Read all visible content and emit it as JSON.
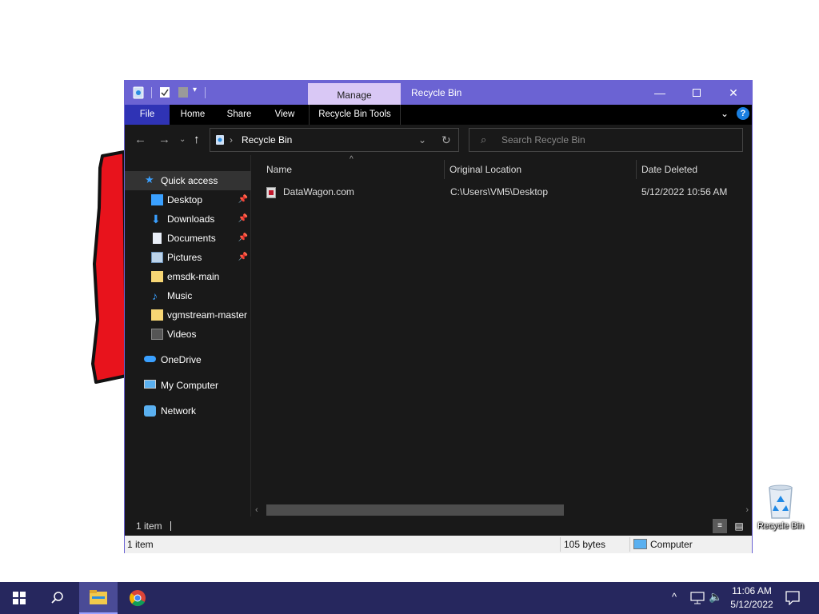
{
  "window": {
    "title": "Recycle Bin",
    "manage_tab": "Manage",
    "ribbon_tabs": [
      "File",
      "Home",
      "Share",
      "View",
      "Recycle Bin Tools"
    ],
    "accent_color": "#6b63d3"
  },
  "address": {
    "path": "Recycle Bin"
  },
  "search": {
    "placeholder": "Search Recycle Bin"
  },
  "sidebar": {
    "items": [
      {
        "label": "Quick access",
        "icon": "star-icon"
      },
      {
        "label": "Desktop",
        "icon": "desktop-icon",
        "pinned": true
      },
      {
        "label": "Downloads",
        "icon": "download-icon",
        "pinned": true
      },
      {
        "label": "Documents",
        "icon": "document-icon",
        "pinned": true
      },
      {
        "label": "Pictures",
        "icon": "pictures-icon",
        "pinned": true
      },
      {
        "label": "emsdk-main",
        "icon": "folder-icon"
      },
      {
        "label": "Music",
        "icon": "music-icon"
      },
      {
        "label": "vgmstream-master",
        "icon": "folder-icon"
      },
      {
        "label": "Videos",
        "icon": "video-icon"
      },
      {
        "label": "OneDrive",
        "icon": "cloud-icon"
      },
      {
        "label": "My Computer",
        "icon": "computer-icon"
      },
      {
        "label": "Network",
        "icon": "network-icon"
      }
    ]
  },
  "table": {
    "columns": [
      "Name",
      "Original Location",
      "Date Deleted"
    ],
    "rows": [
      {
        "name": "DataWagon.com",
        "location": "C:\\Users\\VM5\\Desktop",
        "date": "5/12/2022 10:56 AM"
      }
    ]
  },
  "status": {
    "count": "1 item"
  },
  "bottom": {
    "count": "1 item",
    "size": "105 bytes",
    "location": "Computer"
  },
  "desktop": {
    "icon_label": "Recycle Bin"
  },
  "taskbar": {
    "time": "11:06 AM",
    "date": "5/12/2022"
  }
}
